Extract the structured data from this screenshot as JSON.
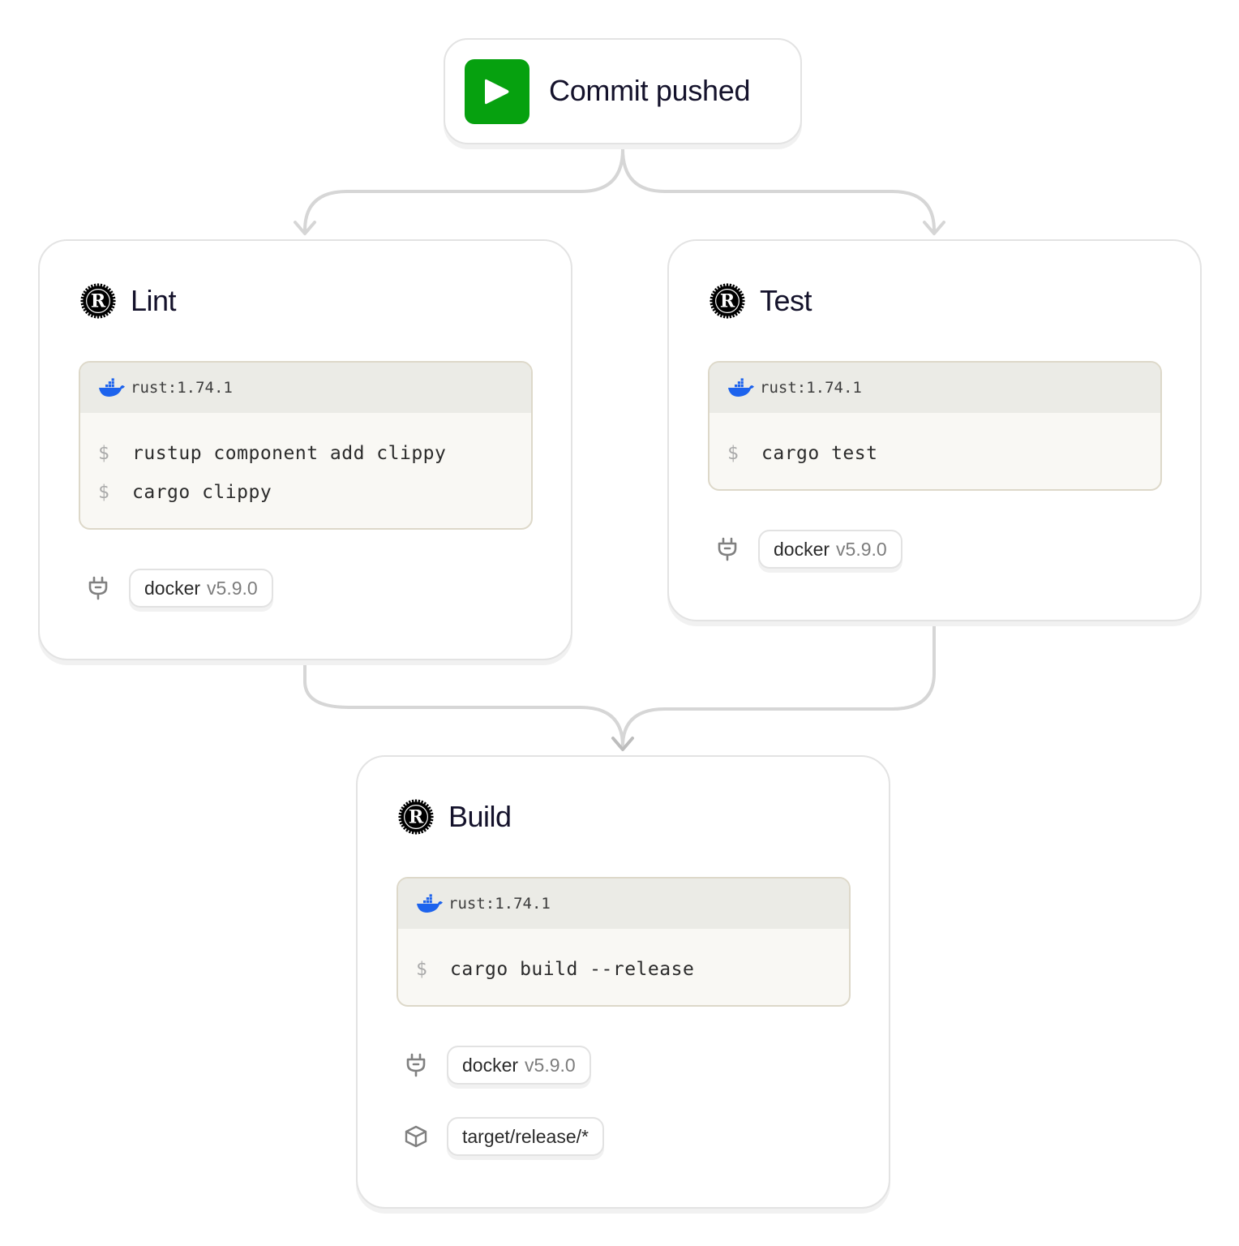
{
  "trigger": {
    "title": "Commit pushed",
    "icon": "play-icon",
    "color": "#06a10f"
  },
  "jobs": {
    "lint": {
      "title": "Lint",
      "icon": "rust-icon",
      "image": "rust:1.74.1",
      "commands": [
        {
          "prompt": "$",
          "text": "rustup component add clippy"
        },
        {
          "prompt": "$",
          "text": "cargo clippy"
        }
      ],
      "plugins": [
        {
          "icon": "plug-icon",
          "name": "docker",
          "version": "v5.9.0"
        }
      ]
    },
    "test": {
      "title": "Test",
      "icon": "rust-icon",
      "image": "rust:1.74.1",
      "commands": [
        {
          "prompt": "$",
          "text": "cargo test"
        }
      ],
      "plugins": [
        {
          "icon": "plug-icon",
          "name": "docker",
          "version": "v5.9.0"
        }
      ]
    },
    "build": {
      "title": "Build",
      "icon": "rust-icon",
      "image": "rust:1.74.1",
      "commands": [
        {
          "prompt": "$",
          "text": "cargo build --release"
        }
      ],
      "plugins": [
        {
          "icon": "plug-icon",
          "name": "docker",
          "version": "v5.9.0"
        }
      ],
      "artifacts": [
        {
          "icon": "package-icon",
          "path": "target/release/*"
        }
      ]
    }
  },
  "edges": [
    {
      "from": "trigger",
      "to": "lint"
    },
    {
      "from": "trigger",
      "to": "test"
    },
    {
      "from": "lint",
      "to": "build"
    },
    {
      "from": "test",
      "to": "build"
    }
  ],
  "colors": {
    "connector": "#d6d6d6",
    "title_text": "#14122b",
    "docker_blue": "#1d63ed",
    "code_header_bg": "#ebebe6",
    "code_body_bg": "#f9f8f4"
  }
}
